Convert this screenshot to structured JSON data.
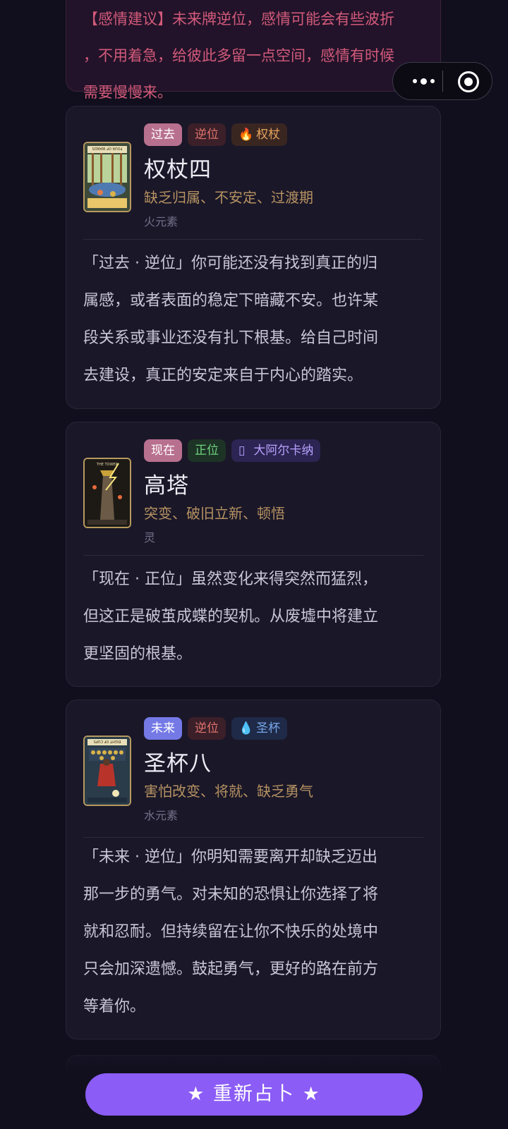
{
  "top_card": {
    "text": "【感情建议】未来牌逆位，感情可能会有些波折\n，不用着急，给彼此多留一点空间，感情有时候\n需要慢慢来。"
  },
  "capsule": {
    "more_icon": "more-dots-icon",
    "close_icon": "target-icon"
  },
  "cards": [
    {
      "position_tag": "过去",
      "orientation_tag": "逆位",
      "suit_icon": "🔥",
      "suit_label": "权杖",
      "name": "权杖四",
      "keywords": "缺乏归属、不安定、过渡期",
      "element": "火元素",
      "image_title": "FOUR OF WANDS",
      "description": "「过去 · 逆位」你可能还没有找到真正的归\n属感，或者表面的稳定下暗藏不安。也许某\n段关系或事业还没有扎下根基。给自己时间\n去建设，真正的安定来自于内心的踏实。"
    },
    {
      "position_tag": "现在",
      "orientation_tag": "正位",
      "suit_icon": "▯",
      "suit_label": "大阿尔卡纳",
      "name": "高塔",
      "keywords": "突变、破旧立新、顿悟",
      "element": "灵",
      "image_title": "THE TOWER",
      "description": "「现在 · 正位」虽然变化来得突然而猛烈，\n但这正是破茧成蝶的契机。从废墟中将建立\n更坚固的根基。"
    },
    {
      "position_tag": "未来",
      "orientation_tag": "逆位",
      "suit_icon": "💧",
      "suit_label": "圣杯",
      "name": "圣杯八",
      "keywords": "害怕改变、将就、缺乏勇气",
      "element": "水元素",
      "image_title": "EIGHT OF CUPS",
      "description": "「未来 · 逆位」你明知需要离开却缺乏迈出\n那一步的勇气。对未知的恐惧让你选择了将\n就和忍耐。但持续留在让你不快乐的处境中\n只会加深遗憾。鼓起勇气，更好的路在前方\n等着你。"
    }
  ],
  "retry_button": {
    "label": "★  重新占卜  ★"
  },
  "colors": {
    "accent": "#8b5cf6",
    "background": "#110f1e",
    "card": "#1a1728"
  }
}
